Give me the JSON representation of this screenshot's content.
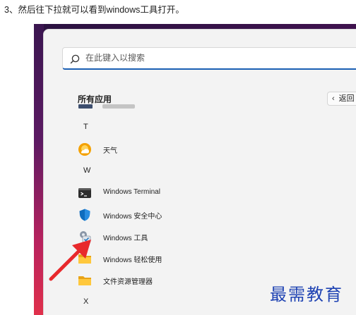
{
  "caption": "3、然后往下拉就可以看到windows工具打开。",
  "search": {
    "placeholder": "在此键入以搜索"
  },
  "section": {
    "title": "所有应用",
    "back_label": "返回"
  },
  "letters": {
    "t": "T",
    "w": "W",
    "x": "X"
  },
  "apps": [
    {
      "label": "天气",
      "icon": "weather-icon"
    },
    {
      "label": "Windows Terminal",
      "icon": "terminal-icon"
    },
    {
      "label": "Windows 安全中心",
      "icon": "shield-icon"
    },
    {
      "label": "Windows 工具",
      "icon": "tools-icon"
    },
    {
      "label": "Windows 轻松使用",
      "icon": "folder-icon",
      "expandable": true
    },
    {
      "label": "文件资源管理器",
      "icon": "folder-icon"
    }
  ],
  "watermark": "最需教育",
  "colors": {
    "accent": "#1a5fb4",
    "arrow": "#e8292c",
    "watermark": "#1f43b3"
  }
}
